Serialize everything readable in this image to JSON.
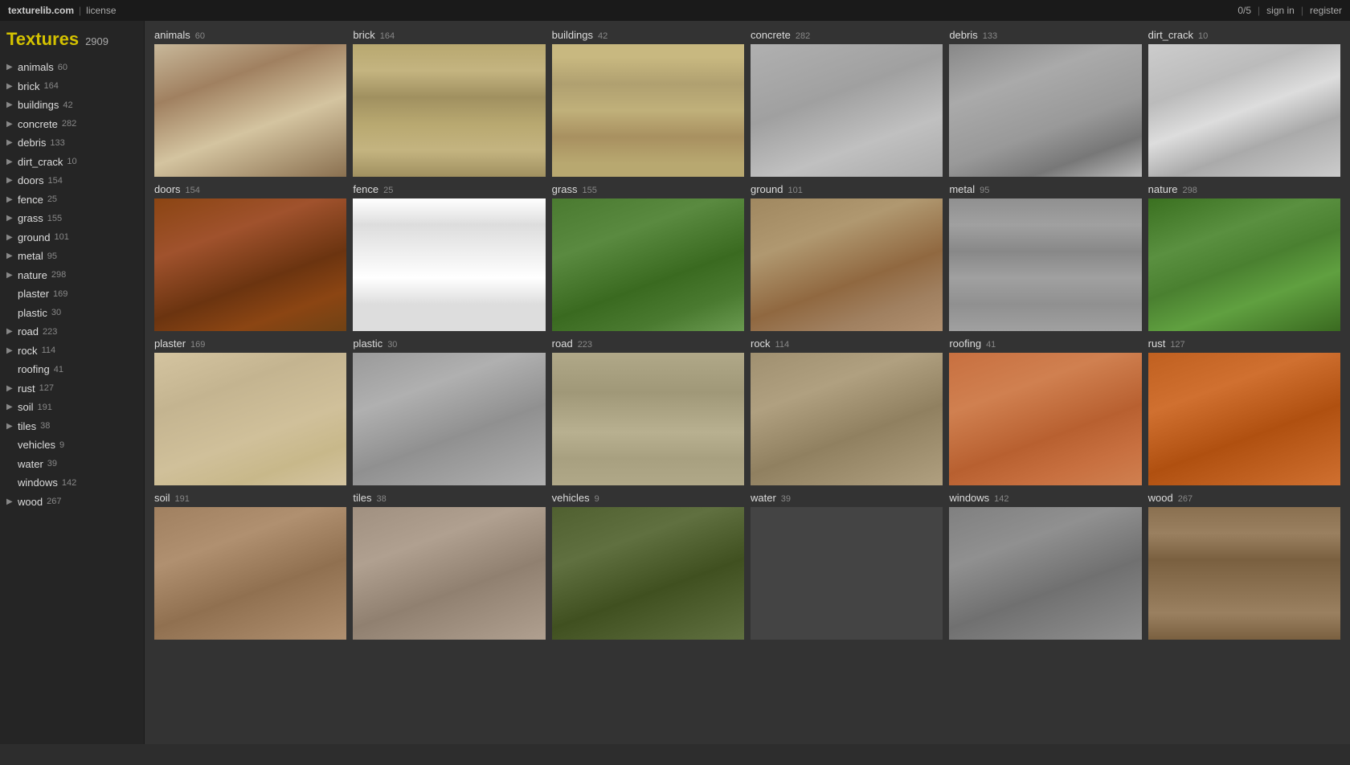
{
  "topbar": {
    "site_name": "texturelib.com",
    "separator": "|",
    "license_link": "license",
    "counter": "0/5",
    "sign_in": "sign in",
    "register": "register"
  },
  "sidebar": {
    "title": "Textures",
    "total_count": "2909",
    "categories": [
      {
        "name": "animals",
        "count": "60",
        "has_arrow": true
      },
      {
        "name": "brick",
        "count": "164",
        "has_arrow": true
      },
      {
        "name": "buildings",
        "count": "42",
        "has_arrow": true
      },
      {
        "name": "concrete",
        "count": "282",
        "has_arrow": true
      },
      {
        "name": "debris",
        "count": "133",
        "has_arrow": true
      },
      {
        "name": "dirt_crack",
        "count": "10",
        "has_arrow": true
      },
      {
        "name": "doors",
        "count": "154",
        "has_arrow": true
      },
      {
        "name": "fence",
        "count": "25",
        "has_arrow": true
      },
      {
        "name": "grass",
        "count": "155",
        "has_arrow": true
      },
      {
        "name": "ground",
        "count": "101",
        "has_arrow": true
      },
      {
        "name": "metal",
        "count": "95",
        "has_arrow": true
      },
      {
        "name": "nature",
        "count": "298",
        "has_arrow": true
      },
      {
        "name": "plaster",
        "count": "169",
        "has_arrow": false
      },
      {
        "name": "plastic",
        "count": "30",
        "has_arrow": false
      },
      {
        "name": "road",
        "count": "223",
        "has_arrow": true
      },
      {
        "name": "rock",
        "count": "114",
        "has_arrow": true
      },
      {
        "name": "roofing",
        "count": "41",
        "has_arrow": false
      },
      {
        "name": "rust",
        "count": "127",
        "has_arrow": true
      },
      {
        "name": "soil",
        "count": "191",
        "has_arrow": true
      },
      {
        "name": "tiles",
        "count": "38",
        "has_arrow": true
      },
      {
        "name": "vehicles",
        "count": "9",
        "has_arrow": false
      },
      {
        "name": "water",
        "count": "39",
        "has_arrow": false
      },
      {
        "name": "windows",
        "count": "142",
        "has_arrow": false
      },
      {
        "name": "wood",
        "count": "267",
        "has_arrow": true
      }
    ]
  },
  "grid": {
    "rows": [
      {
        "cells": [
          {
            "name": "animals",
            "count": "60",
            "img_class": "img-animals"
          },
          {
            "name": "brick",
            "count": "164",
            "img_class": "img-brick"
          },
          {
            "name": "buildings",
            "count": "42",
            "img_class": "img-buildings"
          },
          {
            "name": "concrete",
            "count": "282",
            "img_class": "img-concrete"
          },
          {
            "name": "debris",
            "count": "133",
            "img_class": "img-debris"
          },
          {
            "name": "dirt_crack",
            "count": "10",
            "img_class": "img-dirt_crack"
          }
        ]
      },
      {
        "cells": [
          {
            "name": "doors",
            "count": "154",
            "img_class": "img-doors"
          },
          {
            "name": "fence",
            "count": "25",
            "img_class": "img-fence"
          },
          {
            "name": "grass",
            "count": "155",
            "img_class": "img-grass"
          },
          {
            "name": "ground",
            "count": "101",
            "img_class": "img-ground"
          },
          {
            "name": "metal",
            "count": "95",
            "img_class": "img-metal"
          },
          {
            "name": "nature",
            "count": "298",
            "img_class": "img-nature"
          }
        ]
      },
      {
        "cells": [
          {
            "name": "plaster",
            "count": "169",
            "img_class": "img-plaster"
          },
          {
            "name": "plastic",
            "count": "30",
            "img_class": "img-plastic"
          },
          {
            "name": "road",
            "count": "223",
            "img_class": "img-road"
          },
          {
            "name": "rock",
            "count": "114",
            "img_class": "img-rock"
          },
          {
            "name": "roofing",
            "count": "41",
            "img_class": "img-roofing"
          },
          {
            "name": "rust",
            "count": "127",
            "img_class": "img-rust"
          }
        ]
      },
      {
        "cells": [
          {
            "name": "soil",
            "count": "191",
            "img_class": "img-soil"
          },
          {
            "name": "tiles",
            "count": "38",
            "img_class": "img-tiles"
          },
          {
            "name": "vehicles",
            "count": "9",
            "img_class": "img-vehicles"
          },
          {
            "name": "water",
            "count": "39",
            "img_class": "img-water"
          },
          {
            "name": "windows",
            "count": "142",
            "img_class": "img-windows"
          },
          {
            "name": "wood",
            "count": "267",
            "img_class": "img-wood"
          }
        ]
      }
    ]
  }
}
